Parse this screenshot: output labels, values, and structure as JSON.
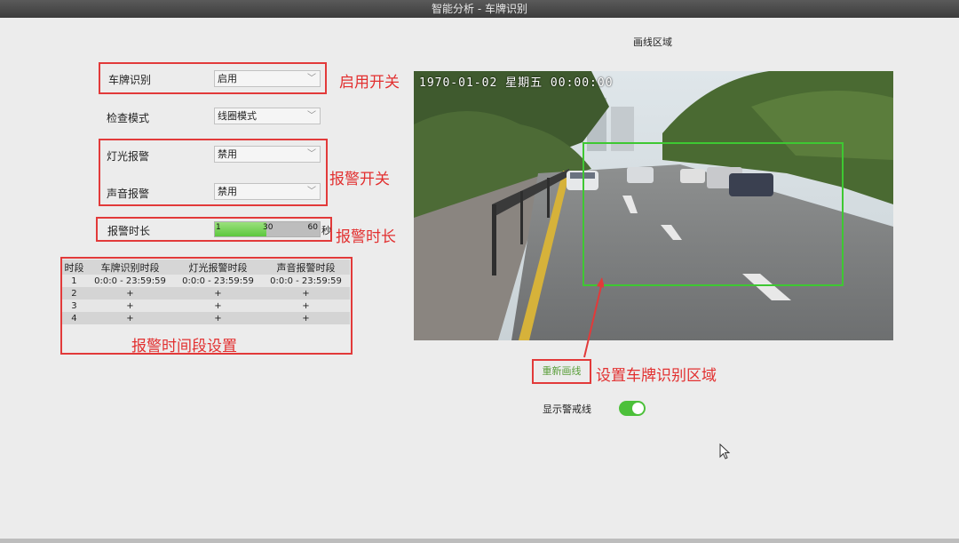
{
  "window": {
    "title": "智能分析 - 车牌识别"
  },
  "form": {
    "plate_recognition": {
      "label": "车牌识别",
      "value": "启用"
    },
    "check_mode": {
      "label": "检查模式",
      "value": "线圈模式"
    },
    "light_alarm": {
      "label": "灯光报警",
      "value": "禁用"
    },
    "sound_alarm": {
      "label": "声音报警",
      "value": "禁用"
    },
    "alarm_duration": {
      "label": "报警时长",
      "min_label": "1",
      "mid_label": "30",
      "max_label": "60",
      "unit": "秒",
      "value": 30,
      "min": 1,
      "max": 60
    }
  },
  "schedule": {
    "headers": [
      "时段",
      "车牌识别时段",
      "灯光报警时段",
      "声音报警时段"
    ],
    "rows": [
      [
        "1",
        "0:0:0 - 23:59:59",
        "0:0:0 - 23:59:59",
        "0:0:0 - 23:59:59"
      ],
      [
        "2",
        "+",
        "+",
        "+"
      ],
      [
        "3",
        "+",
        "+",
        "+"
      ],
      [
        "4",
        "+",
        "+",
        "+"
      ]
    ]
  },
  "preview": {
    "title": "画线区域",
    "osd_text": "1970-01-02 星期五 00:00:00",
    "redraw_label": "重新画线",
    "show_line_label": "显示警戒线",
    "show_line_enabled": true
  },
  "annotations": {
    "enable_switch": "启用开关",
    "alarm_switch": "报警开关",
    "alarm_duration": "报警时长",
    "alarm_period": "报警时间段设置",
    "set_area": "设置车牌识别区域"
  },
  "colors": {
    "annotation_red": "#e23030",
    "zone_green": "#3ec832",
    "toggle_green": "#4cc03a"
  }
}
